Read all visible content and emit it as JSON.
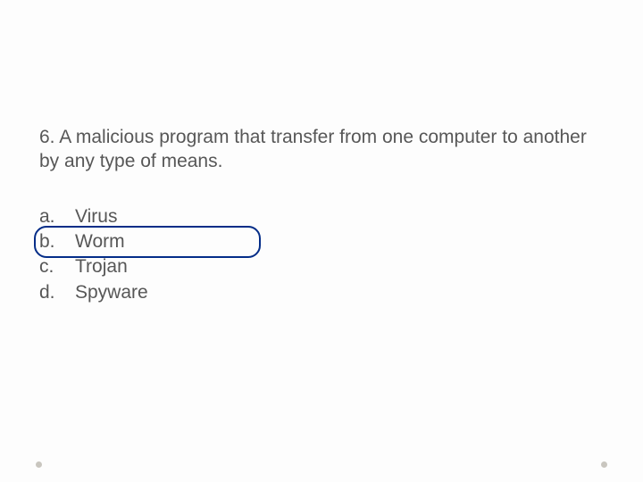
{
  "question": {
    "number": "6.",
    "text": "A malicious program that transfer from one computer to another by any type of means."
  },
  "options": [
    {
      "label": "a.",
      "text": "Virus"
    },
    {
      "label": "b.",
      "text": "Worm"
    },
    {
      "label": "c.",
      "text": "Trojan"
    },
    {
      "label": "d.",
      "text": "Spyware"
    }
  ],
  "highlighted_index": 1
}
